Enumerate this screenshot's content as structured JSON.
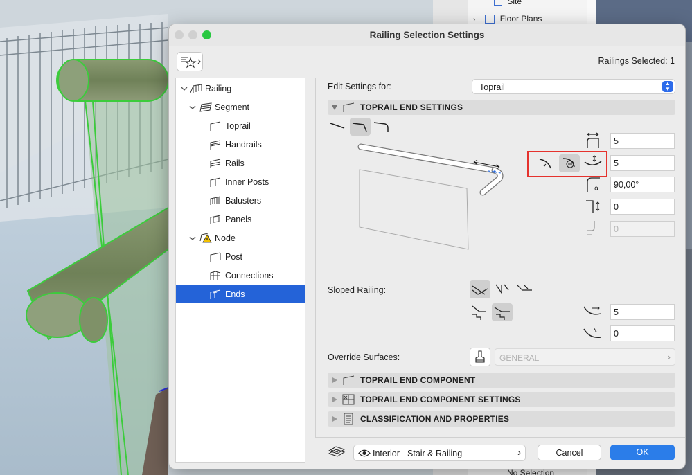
{
  "browser": {
    "items": [
      {
        "label": "Site"
      },
      {
        "label": "Floor Plans"
      }
    ],
    "bottom_status": "No Selection"
  },
  "dialog": {
    "title": "Railing Selection Settings",
    "favorites_icon": "favorites-star-icon",
    "selected_count": "Railings Selected: 1",
    "tree": [
      {
        "label": "Railing",
        "level": 0,
        "expanded": true,
        "icon": "railing-icon"
      },
      {
        "label": "Segment",
        "level": 1,
        "expanded": true,
        "icon": "segment-icon"
      },
      {
        "label": "Toprail",
        "level": 2,
        "icon": "toprail-icon"
      },
      {
        "label": "Handrails",
        "level": 2,
        "icon": "handrails-icon"
      },
      {
        "label": "Rails",
        "level": 2,
        "icon": "rails-icon"
      },
      {
        "label": "Inner Posts",
        "level": 2,
        "icon": "inner-posts-icon"
      },
      {
        "label": "Balusters",
        "level": 2,
        "icon": "balusters-icon"
      },
      {
        "label": "Panels",
        "level": 2,
        "icon": "panels-icon"
      },
      {
        "label": "Node",
        "level": 1,
        "expanded": true,
        "icon": "node-warning-icon"
      },
      {
        "label": "Post",
        "level": 2,
        "icon": "post-icon"
      },
      {
        "label": "Connections",
        "level": 2,
        "icon": "connections-icon"
      },
      {
        "label": "Ends",
        "level": 2,
        "icon": "ends-icon",
        "selected": true
      }
    ],
    "edit_settings_label": "Edit Settings for:",
    "edit_settings_value": "Toprail",
    "section_end_settings": "TOPRAIL END SETTINGS",
    "fields": {
      "width": "5",
      "radius": "5",
      "angle": "90,00°",
      "drop": "0",
      "offset": "0"
    },
    "sloped_label": "Sloped Railing:",
    "sloped_fields": {
      "a": "5",
      "b": "0"
    },
    "override_label": "Override Surfaces:",
    "override_value": "GENERAL",
    "section_component": "TOPRAIL END COMPONENT",
    "section_component_settings": "TOPRAIL END COMPONENT SETTINGS",
    "section_classification": "CLASSIFICATION AND PROPERTIES",
    "layer_value": "Interior - Stair & Railing",
    "cancel_label": "Cancel",
    "ok_label": "OK"
  },
  "colors": {
    "accent": "#2463d8",
    "highlight_box": "#e5322d",
    "close": "#fe5f57",
    "minimize": "#febc2e",
    "zoom": "#28c840"
  }
}
